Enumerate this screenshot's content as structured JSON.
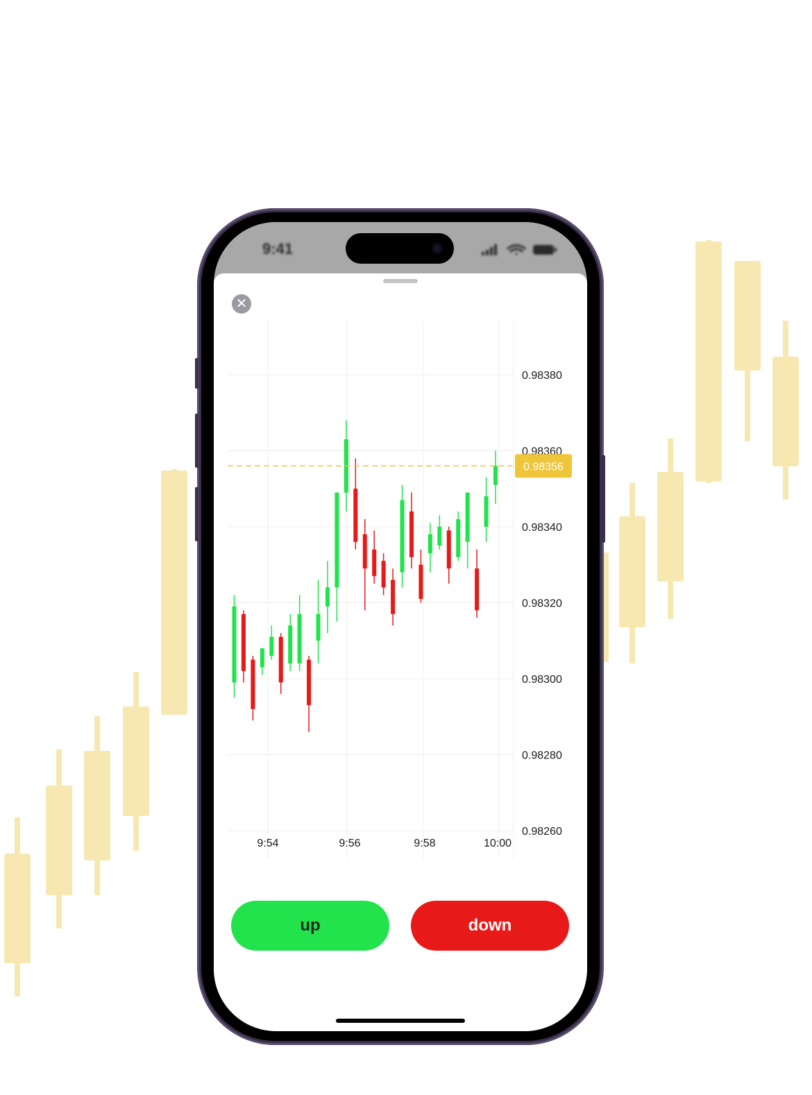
{
  "colors": {
    "background_candles": "#f7e8b2",
    "up_candle": "#22e34c",
    "down_candle": "#e71919",
    "price_marker": "#efc53a",
    "up_button": "#22e34c",
    "down_button": "#e71919"
  },
  "status_bar": {
    "time": "9:41",
    "icons": [
      "cellular-signal-icon",
      "wifi-icon",
      "battery-icon"
    ]
  },
  "sheet": {
    "close_icon": "close-icon"
  },
  "current_price": {
    "value": 0.98356,
    "label": "0.98356"
  },
  "buttons": {
    "up_label": "up",
    "down_label": "down"
  },
  "chart_data": {
    "type": "candlestick",
    "title": "",
    "xlabel": "",
    "ylabel": "",
    "x_ticks": [
      "9:54",
      "9:56",
      "9:58",
      "10:00"
    ],
    "y_ticks": [
      "0.98380",
      "0.98360",
      "0.98340",
      "0.98320",
      "0.98300",
      "0.98280",
      "0.98260"
    ],
    "y_tick_values": [
      0.9838,
      0.9836,
      0.9834,
      0.9832,
      0.983,
      0.9828,
      0.9826
    ],
    "ylim": [
      0.98259,
      0.98394
    ],
    "candles": [
      {
        "o": 0.98299,
        "h": 0.98322,
        "l": 0.98295,
        "c": 0.98319
      },
      {
        "o": 0.98317,
        "h": 0.98318,
        "l": 0.98299,
        "c": 0.98302
      },
      {
        "o": 0.98305,
        "h": 0.98306,
        "l": 0.98289,
        "c": 0.98292
      },
      {
        "o": 0.98303,
        "h": 0.98308,
        "l": 0.98301,
        "c": 0.98308
      },
      {
        "o": 0.98306,
        "h": 0.98314,
        "l": 0.98305,
        "c": 0.98311
      },
      {
        "o": 0.98311,
        "h": 0.98312,
        "l": 0.98296,
        "c": 0.98299
      },
      {
        "o": 0.98304,
        "h": 0.98317,
        "l": 0.98302,
        "c": 0.98314
      },
      {
        "o": 0.98304,
        "h": 0.98322,
        "l": 0.98302,
        "c": 0.98317
      },
      {
        "o": 0.98305,
        "h": 0.98306,
        "l": 0.98286,
        "c": 0.98293
      },
      {
        "o": 0.9831,
        "h": 0.98326,
        "l": 0.98304,
        "c": 0.98317
      },
      {
        "o": 0.98319,
        "h": 0.98331,
        "l": 0.98312,
        "c": 0.98324
      },
      {
        "o": 0.98324,
        "h": 0.98346,
        "l": 0.98315,
        "c": 0.98349
      },
      {
        "o": 0.98349,
        "h": 0.98368,
        "l": 0.98344,
        "c": 0.98363
      },
      {
        "o": 0.9835,
        "h": 0.98358,
        "l": 0.98334,
        "c": 0.98336
      },
      {
        "o": 0.98338,
        "h": 0.98342,
        "l": 0.98318,
        "c": 0.98329
      },
      {
        "o": 0.98334,
        "h": 0.98339,
        "l": 0.98325,
        "c": 0.98327
      },
      {
        "o": 0.98331,
        "h": 0.98333,
        "l": 0.98322,
        "c": 0.98324
      },
      {
        "o": 0.98326,
        "h": 0.98329,
        "l": 0.98314,
        "c": 0.98317
      },
      {
        "o": 0.98328,
        "h": 0.98351,
        "l": 0.98324,
        "c": 0.98347
      },
      {
        "o": 0.98344,
        "h": 0.98349,
        "l": 0.98329,
        "c": 0.98332
      },
      {
        "o": 0.9833,
        "h": 0.98334,
        "l": 0.9832,
        "c": 0.98321
      },
      {
        "o": 0.98333,
        "h": 0.98341,
        "l": 0.98328,
        "c": 0.98338
      },
      {
        "o": 0.98335,
        "h": 0.98343,
        "l": 0.98334,
        "c": 0.9834
      },
      {
        "o": 0.98339,
        "h": 0.9834,
        "l": 0.98325,
        "c": 0.98329
      },
      {
        "o": 0.98332,
        "h": 0.98344,
        "l": 0.98331,
        "c": 0.98342
      },
      {
        "o": 0.98336,
        "h": 0.98347,
        "l": 0.98329,
        "c": 0.98349
      },
      {
        "o": 0.98329,
        "h": 0.98334,
        "l": 0.98316,
        "c": 0.98318
      },
      {
        "o": 0.9834,
        "h": 0.98353,
        "l": 0.98336,
        "c": 0.98348
      },
      {
        "o": 0.98351,
        "h": 0.9836,
        "l": 0.98346,
        "c": 0.98356
      }
    ]
  }
}
